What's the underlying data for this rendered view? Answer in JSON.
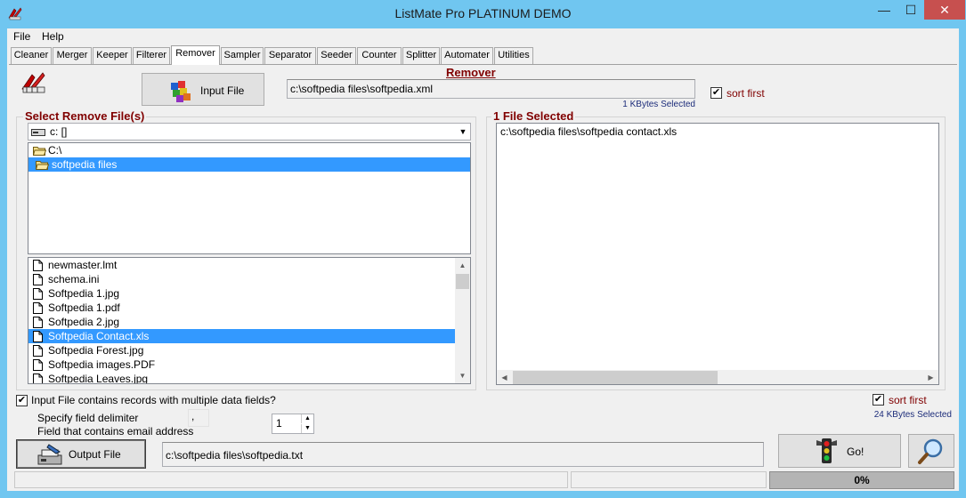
{
  "window": {
    "title": "ListMate Pro PLATINUM DEMO",
    "minimize_glyph": "—",
    "maximize_glyph": "☐",
    "close_glyph": "✕"
  },
  "menu": [
    "File",
    "Help"
  ],
  "tabs": [
    "Cleaner",
    "Merger",
    "Keeper",
    "Filterer",
    "Remover",
    "Sampler",
    "Separator",
    "Seeder",
    "Counter",
    "Splitter",
    "Automater",
    "Utilities"
  ],
  "active_tab": "Remover",
  "remover": {
    "section_title": "Remover",
    "input_file_button": "Input File",
    "input_file_path": "c:\\softpedia files\\softpedia.xml",
    "input_size": "1 KBytes Selected",
    "sort_first_label": "sort first",
    "select_remove_label": "Select Remove File(s)",
    "drive": "c: []",
    "folders": [
      "C:\\",
      "softpedia files"
    ],
    "files": [
      "newmaster.lmt",
      "schema.ini",
      "Softpedia 1.jpg",
      "Softpedia 1.pdf",
      "Softpedia 2.jpg",
      "Softpedia Contact.xls",
      "Softpedia Forest.jpg",
      "Softpedia images.PDF",
      "Softpedia Leaves.jpg"
    ],
    "selected_file_index": 5,
    "files_selected_label": "1 File Selected",
    "selected_files": [
      "c:\\softpedia files\\softpedia contact.xls"
    ],
    "multi_field_label": "Input File contains records with multiple data fields?",
    "delimiter_label": "Specify field delimiter",
    "delimiter_value": ",",
    "email_field_label": "Field that contains email address",
    "email_field_value": "1",
    "sort_first_label_2": "sort first",
    "remove_size": "24 KBytes Selected",
    "output_file_button": "Output File",
    "output_file_path": "c:\\softpedia files\\softpedia.txt",
    "go_button": "Go!",
    "progress": "0%",
    "progress_value": 0
  }
}
